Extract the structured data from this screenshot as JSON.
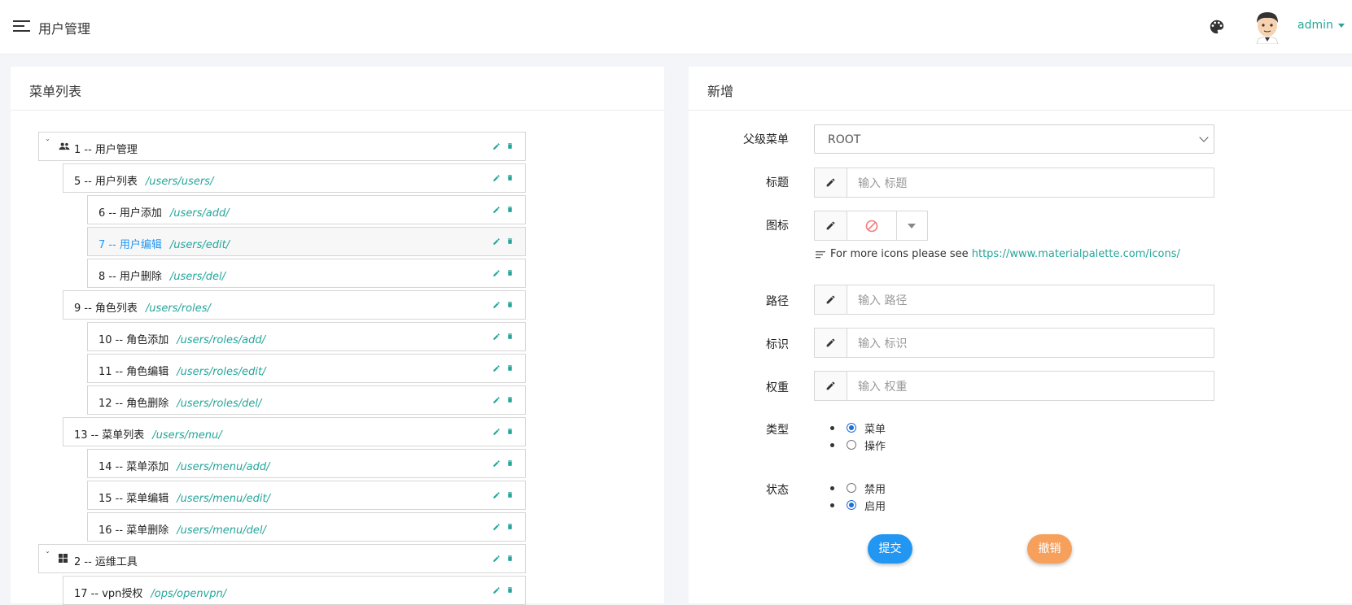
{
  "navbar": {
    "title": "用户管理",
    "username": "admin"
  },
  "left": {
    "title": "菜单列表",
    "rows": [
      {
        "label": "1 -- 用户管理",
        "path": ""
      },
      {
        "label": "5 -- 用户列表",
        "path": "/users/users/"
      },
      {
        "label": "6 -- 用户添加",
        "path": "/users/add/"
      },
      {
        "label": "7 -- 用户编辑",
        "path": "/users/edit/"
      },
      {
        "label": "8 -- 用户删除",
        "path": "/users/del/"
      },
      {
        "label": "9 -- 角色列表",
        "path": "/users/roles/"
      },
      {
        "label": "10 -- 角色添加",
        "path": "/users/roles/add/"
      },
      {
        "label": "11 -- 角色编辑",
        "path": "/users/roles/edit/"
      },
      {
        "label": "12 -- 角色删除",
        "path": "/users/roles/del/"
      },
      {
        "label": "13 -- 菜单列表",
        "path": "/users/menu/"
      },
      {
        "label": "14 -- 菜单添加",
        "path": "/users/menu/add/"
      },
      {
        "label": "15 -- 菜单编辑",
        "path": "/users/menu/edit/"
      },
      {
        "label": "16 -- 菜单删除",
        "path": "/users/menu/del/"
      },
      {
        "label": "2 -- 运维工具",
        "path": ""
      },
      {
        "label": "17 -- vpn授权",
        "path": "/ops/openvpn/"
      }
    ]
  },
  "form": {
    "title": "新增",
    "parent_label": "父级菜单",
    "parent_value": "ROOT",
    "title_label": "标题",
    "title_placeholder": "输入 标题",
    "icon_label": "图标",
    "help_text": "For more icons please see",
    "help_link": "https://www.materialpalette.com/icons/",
    "path_label": "路径",
    "path_placeholder": "输入 路径",
    "mark_label": "标识",
    "mark_placeholder": "输入 标识",
    "weight_label": "权重",
    "weight_placeholder": "输入 权重",
    "type_label": "类型",
    "type_options": [
      "菜单",
      "操作"
    ],
    "type_selected": "菜单",
    "status_label": "状态",
    "status_options": [
      "禁用",
      "启用"
    ],
    "status_selected": "启用",
    "submit_label": "提交",
    "cancel_label": "撤销"
  },
  "colors": {
    "accent": "#26a69a",
    "primary": "#2196f3",
    "warning": "#f7a05c",
    "delete": "#26a69a"
  }
}
